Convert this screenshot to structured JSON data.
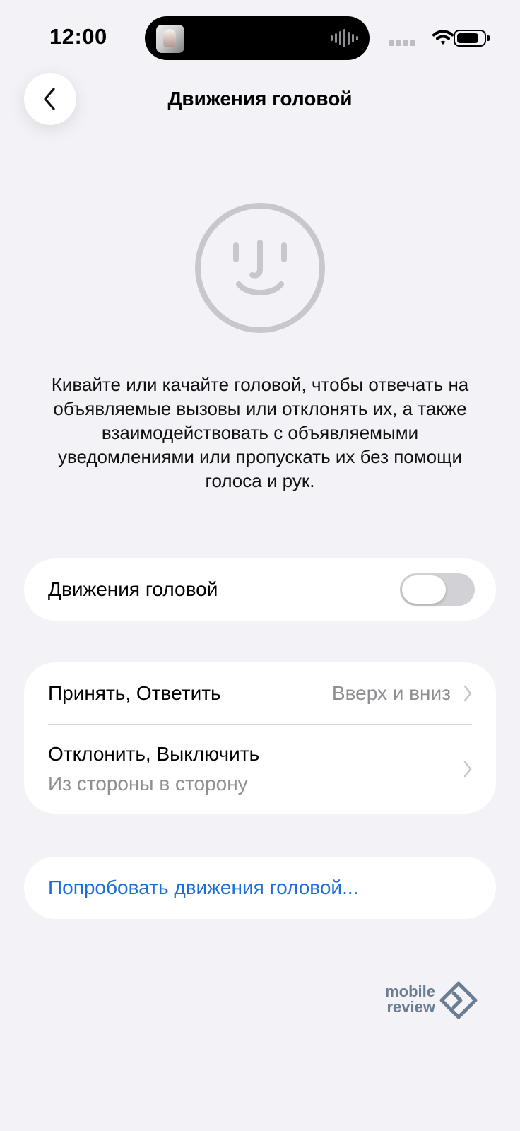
{
  "status_bar": {
    "time": "12:00"
  },
  "header": {
    "back_icon": "chevron-left-icon",
    "title": "Движения головой"
  },
  "hero": {
    "icon": "face-icon",
    "description": "Кивайте или качайте головой, чтобы отвечать на объявляемые вызовы или отклонять их, а также взаимодействовать с объявляемыми уведомлениями или пропускать их без помощи голоса и рук."
  },
  "settings": {
    "toggle": {
      "label": "Движения головой",
      "state": "off"
    },
    "rows": [
      {
        "label": "Принять, Ответить",
        "value": "Вверх и вниз",
        "icon": "chevron-right-icon"
      },
      {
        "label": "Отклонить, Выключить",
        "sublabel": "Из стороны в сторону",
        "icon": "chevron-right-icon"
      }
    ],
    "try_link": "Попробовать движения головой..."
  },
  "watermark": {
    "line1": "mobile",
    "line2": "review"
  },
  "colors": {
    "background": "#f2f2f7",
    "card": "#ffffff",
    "secondary_text": "#8e8e93",
    "link": "#1f6ed8",
    "icon_gray": "#c7c7cc",
    "watermark": "#6a7d92"
  }
}
